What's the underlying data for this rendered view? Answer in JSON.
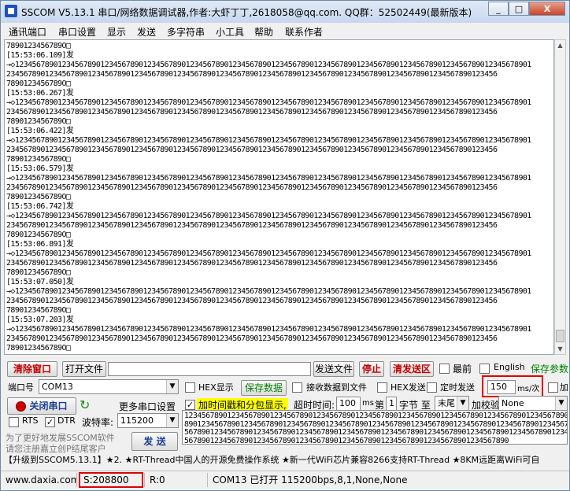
{
  "window": {
    "title": "SSCOM V5.13.1 串口/网络数据调试器,作者:大虾丁丁,2618058@qq.com. QQ群：52502449(最新版本)",
    "minimize": "_",
    "maximize": "□",
    "close": "X"
  },
  "menu": [
    "通讯端口",
    "串口设置",
    "显示",
    "发送",
    "多字符串",
    "小工具",
    "帮助",
    "联系作者"
  ],
  "output": {
    "lines": [
      "7890123456789O□",
      "[15:53:06.109]发",
      "→◇1234567890123456789012345678901234567890123456789012345678901234567890123456789012345678901234567890123456789012345678901",
      "2345678901234567890123456789012345678901234567890123456789012345678901234567890123456789012345678901234567890123456",
      "7890123456789O□",
      "[15:53:06.267]发",
      "→◇1234567890123456789012345678901234567890123456789012345678901234567890123456789012345678901234567890123456789012345678901",
      "2345678901234567890123456789012345678901234567890123456789012345678901234567890123456789012345678901234567890123456",
      "7890123456789O□",
      "[15:53:06.422]发",
      "→◇1234567890123456789012345678901234567890123456789012345678901234567890123456789012345678901234567890123456789012345678901",
      "2345678901234567890123456789012345678901234567890123456789012345678901234567890123456789012345678901234567890123456",
      "7890123456789O□",
      "[15:53:06.579]发",
      "→◇1234567890123456789012345678901234567890123456789012345678901234567890123456789012345678901234567890123456789012345678901",
      "2345678901234567890123456789012345678901234567890123456789012345678901234567890123456789012345678901234567890123456",
      "7890123456789O□",
      "[15:53:06.742]发",
      "→◇1234567890123456789012345678901234567890123456789012345678901234567890123456789012345678901234567890123456789012345678901",
      "2345678901234567890123456789012345678901234567890123456789012345678901234567890123456789012345678901234567890123456",
      "7890123456789O□",
      "[15:53:06.891]发",
      "→◇1234567890123456789012345678901234567890123456789012345678901234567890123456789012345678901234567890123456789012345678901",
      "2345678901234567890123456789012345678901234567890123456789012345678901234567890123456789012345678901234567890123456",
      "7890123456789O□",
      "[15:53:07.050]发",
      "→◇1234567890123456789012345678901234567890123456789012345678901234567890123456789012345678901234567890123456789012345678901",
      "2345678901234567890123456789012345678901234567890123456789012345678901234567890123456789012345678901234567890123456",
      "7890123456789O□",
      "[15:53:07.203]发",
      "→◇1234567890123456789012345678901234567890123456789012345678901234567890123456789012345678901234567890123456789012345678901",
      "2345678901234567890123456789012345678901234567890123456789012345678901234567890123456789012345678901234567890123456",
      "7890123456789O□"
    ]
  },
  "toolbar": {
    "clear_window": "清除窗口",
    "open_file": "打开文件",
    "file_path": "",
    "send_file": "发送文件",
    "stop": "停止",
    "clear_send": "清发送区",
    "topmost": "最前",
    "english": "English",
    "save_params": "保存参数"
  },
  "port": {
    "label": "端口号",
    "value": "COM13",
    "hex_display": "HEX显示",
    "save_data": "保存数据",
    "recv_to_file": "接收数据到文件",
    "hex_send": "HEX发送",
    "timed_send": "定时发送",
    "interval": "150",
    "interval_unit": "ms/次",
    "crlf": "加"
  },
  "controls": {
    "close_port": "关闭串口",
    "more_settings": "更多串口设置",
    "timestamp": "加时间戳和分包显示,",
    "timeout_label": "超时时间:",
    "timeout_value": "100",
    "timeout_unit": "ms",
    "nth_label": "第",
    "nth_value": "1",
    "byte_label": "字节 至",
    "end_value": "末尾",
    "checksum_label": "加校验",
    "checksum_value": "None",
    "rts": "RTS",
    "dtr": "DTR",
    "baud_label": "波特率:",
    "baud_value": "115200",
    "promo_line1": "为了更好地发展SSCOM软件",
    "promo_line2": "请您注册嘉立创P结尾客户",
    "send": "发 送"
  },
  "send_area": {
    "lines": [
      "1234567890123456789012345678901234567890123456789012345678901234567890123456789012345678901234567",
      "8901234567890123456789012345678901234567890123456789012345678901234567890123456789012345678901234",
      "5678901234567890123456789012345678901234567890123456789012345678901234567890123456789012345678901",
      "5678901234567890123456789012345678901234567890123456789012345678901234567890"
    ]
  },
  "marquee": "【升级到SSCOM5.13.1】★2. ★RT-Thread中国人的开源免费操作系统 ★新一代WiFi芯片兼容8266支持RT-Thread ★8KM远距离WiFi可自",
  "status": {
    "website": "www.daxia.com",
    "sent": "S:208800",
    "received": "R:0",
    "port_state": "COM13 已打开  115200bps,8,1,None,None"
  },
  "colors": {
    "highlight_box": "#e00000",
    "clear_button_text": "#c00000",
    "save_text": "#008000",
    "timestamp_bg": "#ffff00"
  }
}
